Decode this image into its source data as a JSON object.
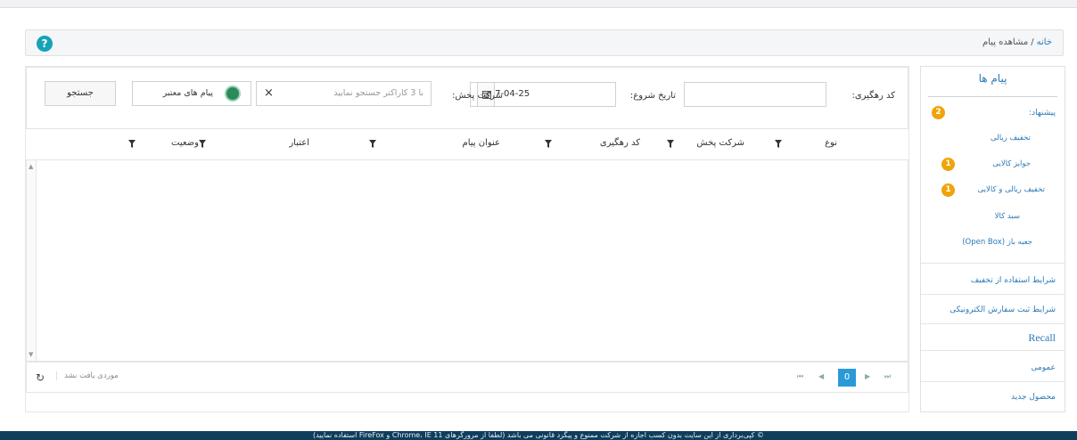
{
  "breadcrumb": {
    "home": "خانه",
    "separator": "/",
    "current": "مشاهده پیام"
  },
  "help": {
    "glyph": "?"
  },
  "sidebar": {
    "title": "پیام ها",
    "suggestions_label": "پیشنهاد:",
    "suggestions_count": "2",
    "sub_items": [
      {
        "label": "تخفیف ریالی",
        "badge": ""
      },
      {
        "label": "جوایز کالایی",
        "badge": "1"
      },
      {
        "label": "تخفیف ریالی و کالایی",
        "badge": "1"
      },
      {
        "label": "سبد کالا",
        "badge": ""
      },
      {
        "label": "جعبه باز (Open Box)",
        "badge": ""
      }
    ],
    "items": [
      "شرایط استفاده از تخفیف",
      "شرایط ثبت سفارش الکترونیکی",
      "Recall",
      "عمومی",
      "محصول جدید"
    ]
  },
  "filters": {
    "tracking_code_label": "کد رهگیری:",
    "tracking_code_value": "",
    "start_date_label": "تاریخ شروع:",
    "start_date_value": "1397-04-25",
    "company_label": "شرکت پخش:",
    "company_placeholder": "با 3 کاراکتر جستجو نمایید",
    "valid_messages_label": "پیام های معتبر",
    "search_button": "جستجو"
  },
  "grid": {
    "columns": [
      "نوع",
      "شرکت پخش",
      "کد رهگیری",
      "عنوان پیام",
      "اعتبار",
      "وضعیت"
    ],
    "rows": []
  },
  "pager": {
    "current_page": "0",
    "no_items_text": "موردی یافت نشد"
  },
  "footer": {
    "text": "© کپی‌برداری از این سایت بدون کسب اجازه از شرکت ممنوع و پیگرد قانونی می باشد (لطفا از مرورگرهای Chrome، IE 11 و FireFox استفاده نمایید)"
  },
  "colors": {
    "accent": "#2a7ab8",
    "badge": "#f0a30a",
    "page_active": "#2a9ad6",
    "footer_bg": "#0f3d5c"
  }
}
